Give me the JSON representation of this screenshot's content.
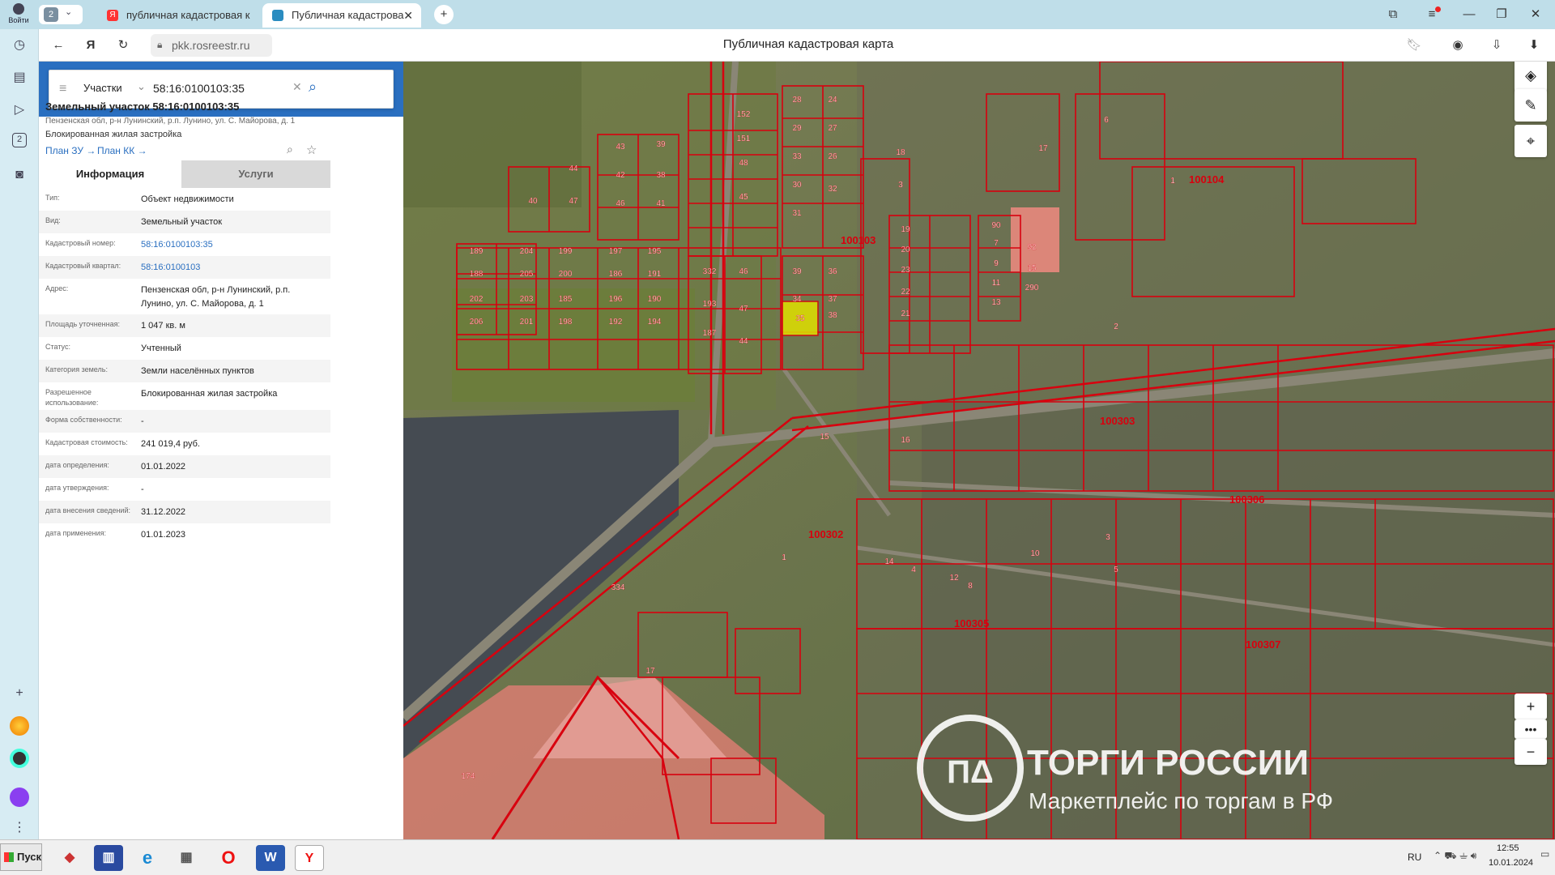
{
  "browser": {
    "tab_count": "2",
    "login_label": "Войти",
    "tabs": [
      {
        "title": "публичная кадастровая к"
      },
      {
        "title": "Публичная кадастрова"
      }
    ],
    "url": "pkk.rosreestr.ru",
    "page_title": "Публичная кадастровая карта"
  },
  "panel": {
    "search": {
      "mode": "Участки",
      "query": "58:16:0100103:35"
    },
    "card": {
      "title": "Земельный участок 58:16:0100103:35",
      "address_small": "Пензенская обл, р-н Лунинский, р.п. Лунино, ул. С. Майорова, д. 1",
      "usage_small": "Блокированная жилая застройка",
      "plan_zu": "План ЗУ →",
      "plan_kk": "План КК →"
    },
    "tabs": {
      "info": "Информация",
      "services": "Услуги"
    },
    "rows": [
      {
        "key": "Тип:",
        "value": "Объект недвижимости"
      },
      {
        "key": "Вид:",
        "value": "Земельный участок"
      },
      {
        "key": "Кадастровый номер:",
        "value": "58:16:0100103:35"
      },
      {
        "key": "Кадастровый квартал:",
        "value": "58:16:0100103"
      },
      {
        "key": "Адрес:",
        "value": "Пензенская обл, р-н Лунинский, р.п. Лунино, ул. С. Майорова, д. 1"
      },
      {
        "key": "Площадь уточненная:",
        "value": "1 047 кв. м"
      },
      {
        "key": "Статус:",
        "value": "Учтенный"
      },
      {
        "key": "Категория земель:",
        "value": "Земли населённых пунктов"
      },
      {
        "key": "Разрешенное использование:",
        "value": "Блокированная жилая застройка"
      },
      {
        "key": "Форма собственности:",
        "value": "-"
      },
      {
        "key": "Кадастровая стоимость:",
        "value": "241 019,4 руб."
      },
      {
        "key": "дата определения:",
        "value": "01.01.2022"
      },
      {
        "key": "дата утверждения:",
        "value": "-"
      },
      {
        "key": "дата внесения сведений:",
        "value": "31.12.2022"
      },
      {
        "key": "дата применения:",
        "value": "01.01.2023"
      }
    ]
  },
  "map": {
    "quarters": [
      "100103",
      "100104",
      "100303",
      "100306",
      "100302",
      "100305",
      "100307"
    ],
    "parcels": [
      "28",
      "24",
      "29",
      "27",
      "33",
      "26",
      "30",
      "31",
      "32",
      "18",
      "17",
      "6",
      "3",
      "19",
      "20",
      "23",
      "22",
      "21",
      "90",
      "7",
      "9",
      "11",
      "13",
      "92",
      "15",
      "290",
      "39",
      "36",
      "34",
      "37",
      "35",
      "38",
      "46",
      "47",
      "44",
      "332",
      "193",
      "187",
      "189",
      "188",
      "202",
      "206",
      "204",
      "205",
      "203",
      "201",
      "199",
      "200",
      "185",
      "198",
      "197",
      "186",
      "196",
      "192",
      "195",
      "191",
      "190",
      "194",
      "40",
      "47",
      "44",
      "43",
      "42",
      "46",
      "41",
      "39",
      "38",
      "152",
      "151",
      "48",
      "45",
      "1",
      "2",
      "3",
      "5",
      "4",
      "16",
      "14",
      "12",
      "8",
      "10",
      "174",
      "334",
      "17",
      "15",
      "1"
    ],
    "selected_parcel": "35",
    "watermark_title": "ТОРГИ РОССИИ",
    "watermark_sub": "Маркетплейс по торгам в РФ"
  },
  "taskbar": {
    "start": "Пуск",
    "lang": "RU",
    "time": "12:55",
    "date": "10.01.2024"
  },
  "colors": {
    "accent": "#2a6fc0",
    "parcel_line": "#d8000e",
    "selected": "#e0e000",
    "tab_bg": "#bfdee9"
  }
}
